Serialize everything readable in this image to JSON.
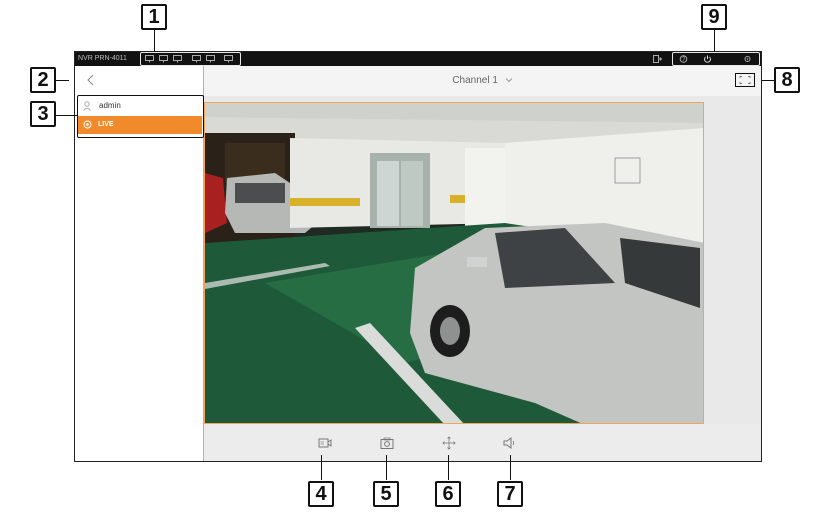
{
  "callouts": [
    "1",
    "2",
    "3",
    "4",
    "5",
    "6",
    "7",
    "8",
    "9"
  ],
  "topbar": {
    "model": "NVR PRN-4011",
    "left_icons": [
      "monitor-icon",
      "monitor-icon",
      "monitor-icon",
      "monitor-icon",
      "monitor-icon",
      "monitor-icon"
    ],
    "right_icons": [
      "logout-icon",
      "help-icon",
      "power-icon",
      "settings-icon"
    ]
  },
  "sidebar": {
    "back_icon": "chevron-left-icon",
    "user": {
      "icon": "user-icon",
      "label": "admin"
    },
    "live": {
      "icon": "camera-icon",
      "label": "LIVE"
    }
  },
  "main": {
    "channel_title": "Channel 1",
    "channel_dropdown_icon": "chevron-down-icon",
    "fullscreen_icon": "fullscreen-icon"
  },
  "controls": {
    "icons": [
      "record-icon",
      "snapshot-icon",
      "ptz-move-icon",
      "audio-icon"
    ]
  },
  "colors": {
    "accent": "#f08a2a",
    "topbar": "#121212",
    "panel": "#e9e9e9"
  }
}
